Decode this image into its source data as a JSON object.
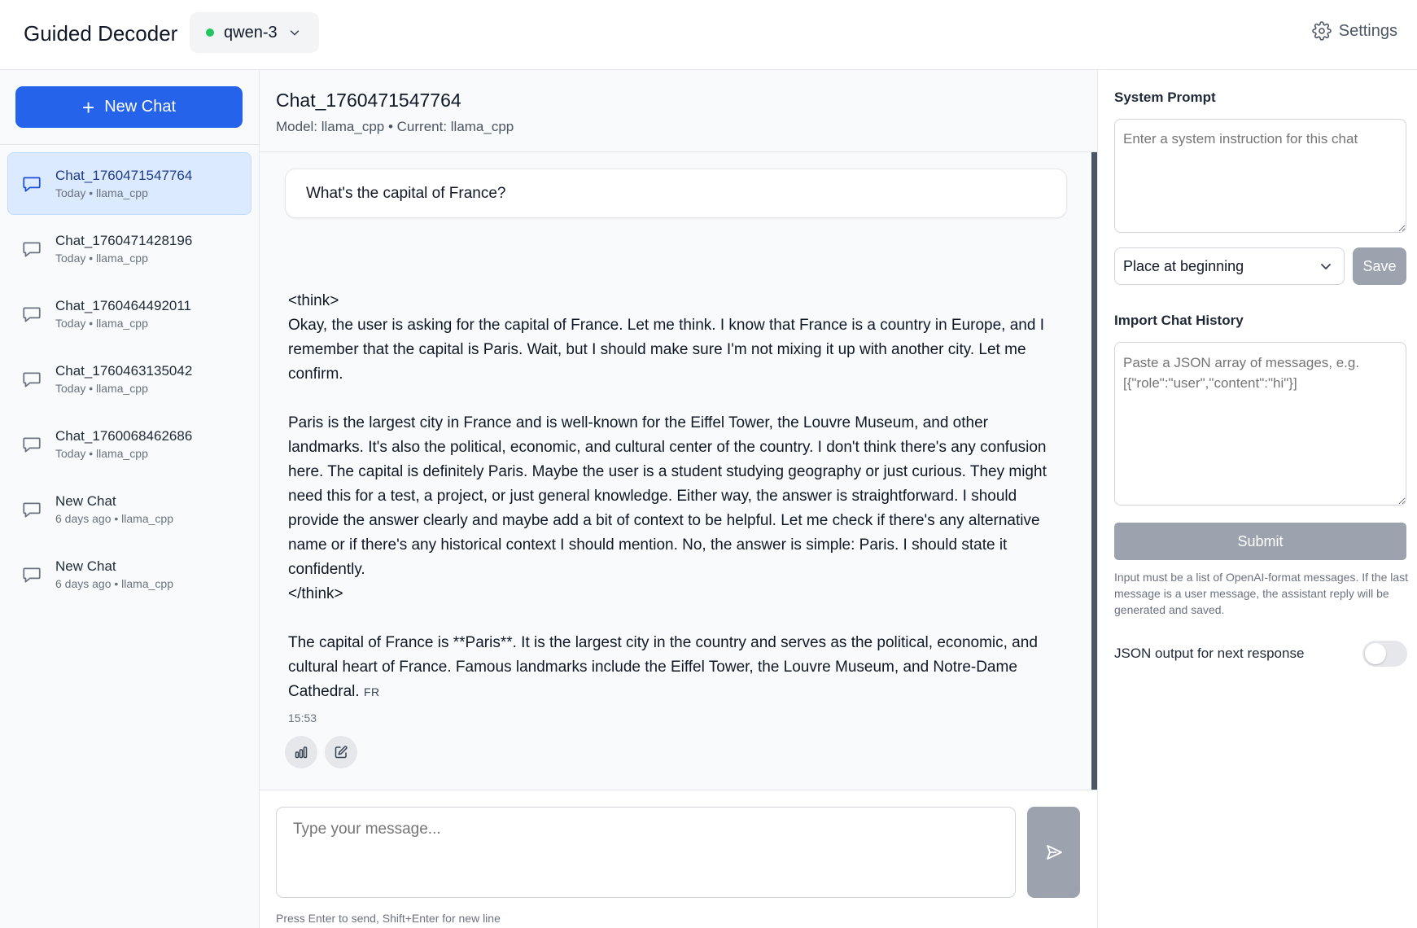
{
  "app": {
    "title": "Guided Decoder"
  },
  "model_selector": {
    "value": "qwen-3",
    "status_color": "#22c55e"
  },
  "settings": {
    "label": "Settings",
    "icon": "gear-icon"
  },
  "sidebar": {
    "new_chat_label": "New Chat",
    "items": [
      {
        "name": "Chat_1760471547764",
        "meta": "Today • llama_cpp",
        "active": true
      },
      {
        "name": "Chat_1760471428196",
        "meta": "Today • llama_cpp",
        "active": false
      },
      {
        "name": "Chat_1760464492011",
        "meta": "Today • llama_cpp",
        "active": false
      },
      {
        "name": "Chat_1760463135042",
        "meta": "Today • llama_cpp",
        "active": false
      },
      {
        "name": "Chat_1760068462686",
        "meta": "Today • llama_cpp",
        "active": false
      },
      {
        "name": "New Chat",
        "meta": "6 days ago • llama_cpp",
        "active": false
      },
      {
        "name": "New Chat",
        "meta": "6 days ago • llama_cpp",
        "active": false
      }
    ]
  },
  "chat": {
    "title": "Chat_1760471547764",
    "subtitle": "Model: llama_cpp • Current: llama_cpp",
    "user_message": "What's the capital of France?",
    "assistant_message": "<think>\nOkay, the user is asking for the capital of France. Let me think. I know that France is a country in Europe, and I remember that the capital is Paris. Wait, but I should make sure I'm not mixing it up with another city. Let me confirm.\n\nParis is the largest city in France and is well-known for the Eiffel Tower, the Louvre Museum, and other landmarks. It's also the political, economic, and cultural center of the country. I don't think there's any confusion here. The capital is definitely Paris. Maybe the user is a student studying geography or just curious. They might need this for a test, a project, or just general knowledge. Either way, the answer is straightforward. I should provide the answer clearly and maybe add a bit of context to be helpful. Let me check if there's any alternative name or if there's any historical context I should mention. No, the answer is simple: Paris. I should state it confidently.\n</think>\n\nThe capital of France is **Paris**. It is the largest city in the country and serves as the political, economic, and cultural heart of France. Famous landmarks include the Eiffel Tower, the Louvre Museum, and Notre-Dame Cathedral. ",
    "lang_tag": "FR",
    "timestamp": "15:53"
  },
  "composer": {
    "placeholder": "Type your message...",
    "hint": "Press Enter to send, Shift+Enter for new line"
  },
  "right_panel": {
    "system_prompt_label": "System Prompt",
    "system_prompt_placeholder": "Enter a system instruction for this chat",
    "placement_value": "Place at beginning",
    "save_label": "Save",
    "import_label": "Import Chat History",
    "import_placeholder": "Paste a JSON array of messages, e.g. [{\"role\":\"user\",\"content\":\"hi\"}]",
    "submit_label": "Submit",
    "help_text": "Input must be a list of OpenAI-format messages. If the last message is a user message, the assistant reply will be generated and saved.",
    "json_toggle_label": "JSON output for next response",
    "json_toggle_on": false
  }
}
